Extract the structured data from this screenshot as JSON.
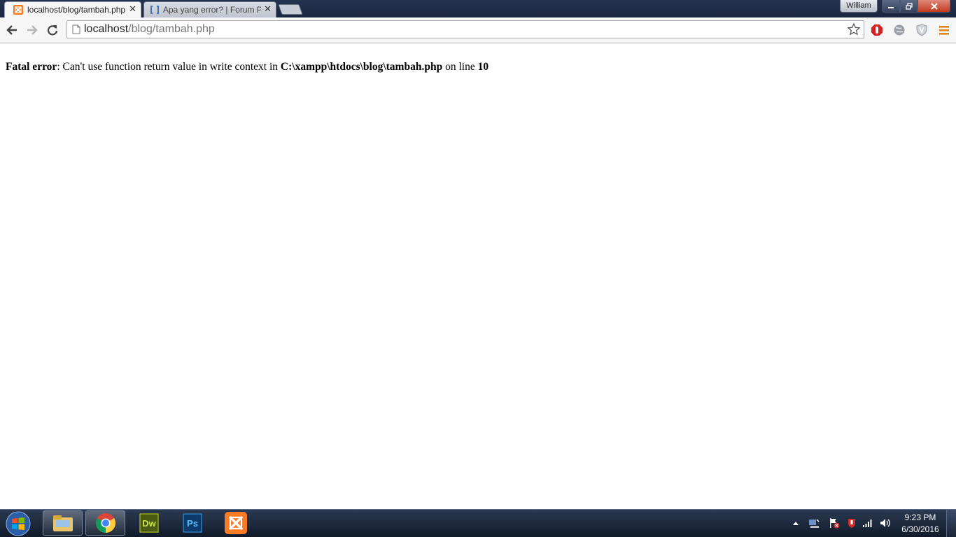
{
  "tabs": [
    {
      "title": "localhost/blog/tambah.php",
      "active": true,
      "favicon": "xampp-icon"
    },
    {
      "title": "Apa yang error? | Forum P",
      "active": false,
      "favicon": "brackets-icon"
    }
  ],
  "window": {
    "user": "William"
  },
  "address_bar": {
    "host": "localhost",
    "path": "/blog/tambah.php"
  },
  "page": {
    "error_label": "Fatal error",
    "error_sep": ": ",
    "error_message": "Can't use function return value in write context in ",
    "error_file": "C:\\xampp\\htdocs\\blog\\tambah.php",
    "error_on_line": " on line ",
    "error_line": "10"
  },
  "taskbar": {
    "apps": [
      "windows-explorer",
      "google-chrome",
      "dreamweaver",
      "photoshop",
      "xampp"
    ],
    "dw_label": "Dw",
    "ps_label": "Ps",
    "time": "9:23 PM",
    "date": "6/30/2016"
  },
  "colors": {
    "chrome_accent": "#1b2740",
    "xampp_orange": "#fb7a24",
    "error_text": "#000000"
  }
}
